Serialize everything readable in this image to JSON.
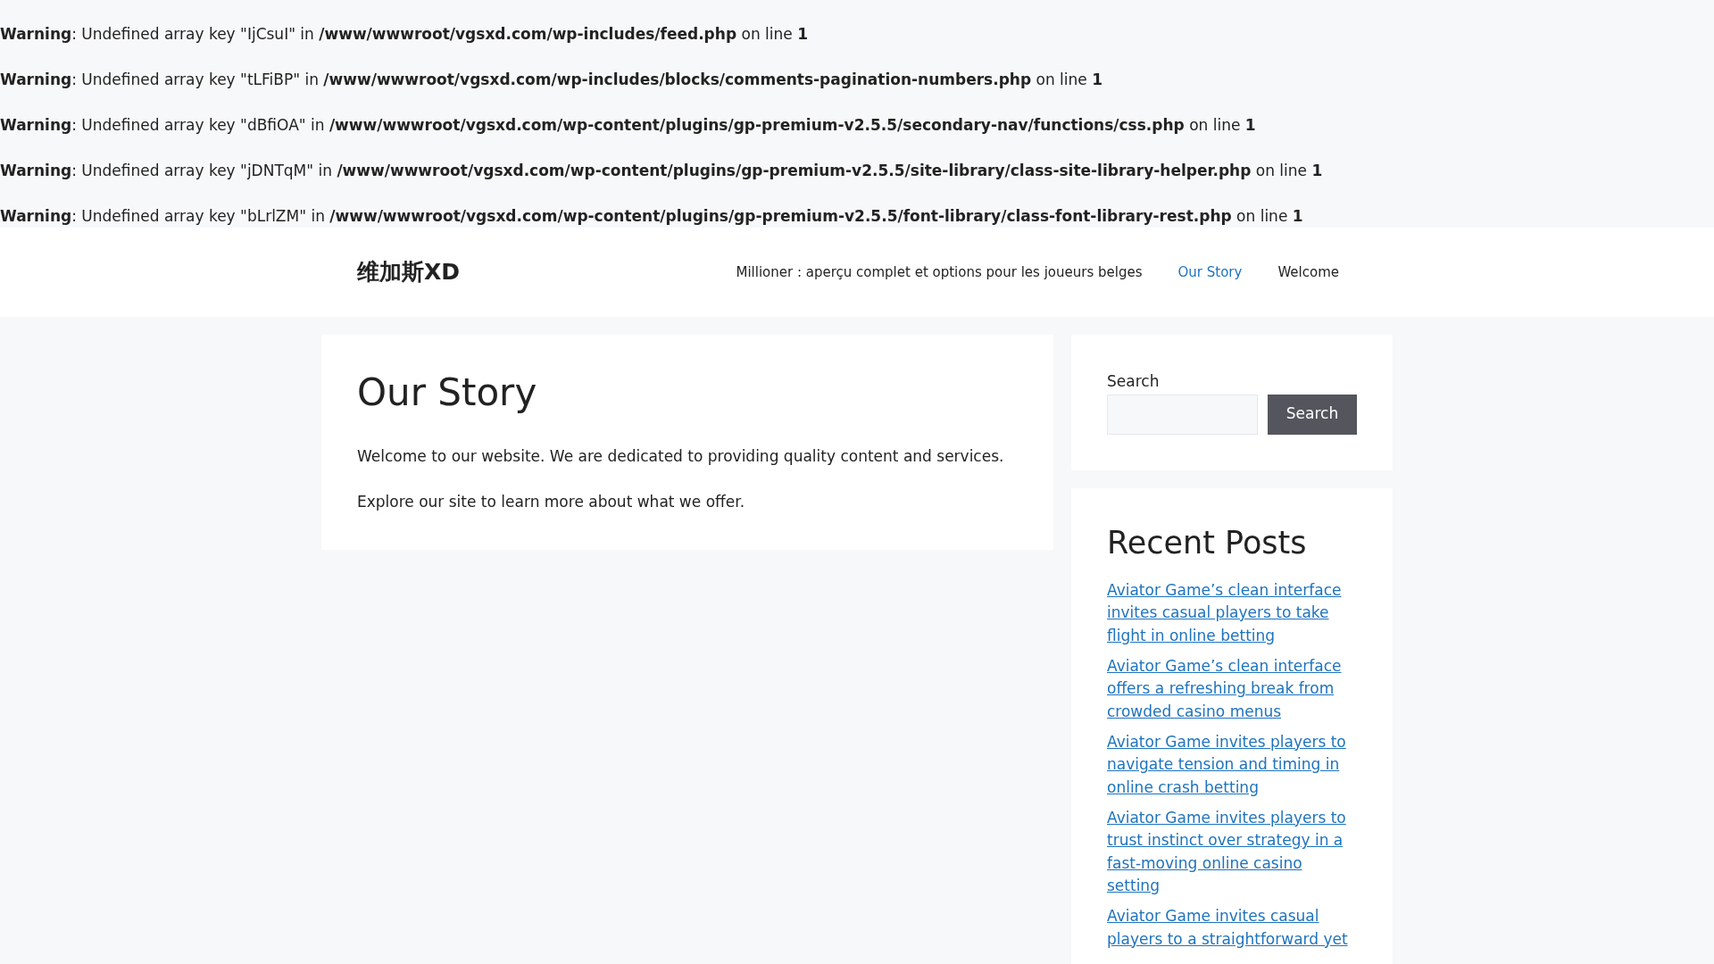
{
  "warnings": [
    "**Warning**: Undefined array key \"IjCsuI\" in **/www/wwwroot/vgsxd.com/wp-includes/feed.php** on line **1**",
    "**Warning**: Undefined array key \"tLFiBP\" in **/www/wwwroot/vgsxd.com/wp-includes/blocks/comments-pagination-numbers.php** on line **1**",
    "**Warning**: Undefined array key \"dBfiOA\" in **/www/wwwroot/vgsxd.com/wp-content/plugins/gp-premium-v2.5.5/secondary-nav/functions/css.php** on line **1**",
    "**Warning**: Undefined array key \"jDNTqM\" in **/www/wwwroot/vgsxd.com/wp-content/plugins/gp-premium-v2.5.5/site-library/class-site-library-helper.php** on line **1**",
    "**Warning**: Undefined array key \"bLrlZM\" in **/www/wwwroot/vgsxd.com/wp-content/plugins/gp-premium-v2.5.5/font-library/class-font-library-rest.php** on line **1**"
  ],
  "header": {
    "site_title": "维加斯XD",
    "nav": [
      {
        "label": "Millioner : aperçu complet et options pour les joueurs belges",
        "selected": false
      },
      {
        "label": "Our Story",
        "selected": true
      },
      {
        "label": "Welcome",
        "selected": false
      }
    ]
  },
  "article": {
    "title": "Our Story",
    "paragraphs": [
      "Welcome to our website. We are dedicated to providing quality content and services.",
      "Explore our site to learn more about what we offer."
    ]
  },
  "sidebar": {
    "search": {
      "label": "Search",
      "button": "Search"
    },
    "recent_posts": {
      "title": "Recent Posts",
      "posts": [
        "Aviator Game’s clean interface invites casual players to take flight in online betting",
        "Aviator Game’s clean interface offers a refreshing break from crowded casino menus",
        "Aviator Game invites players to navigate tension and timing in online crash betting",
        "Aviator Game invites players to trust instinct over strategy in a fast-moving online casino setting",
        "Aviator Game invites casual players to a straightforward yet"
      ]
    }
  }
}
